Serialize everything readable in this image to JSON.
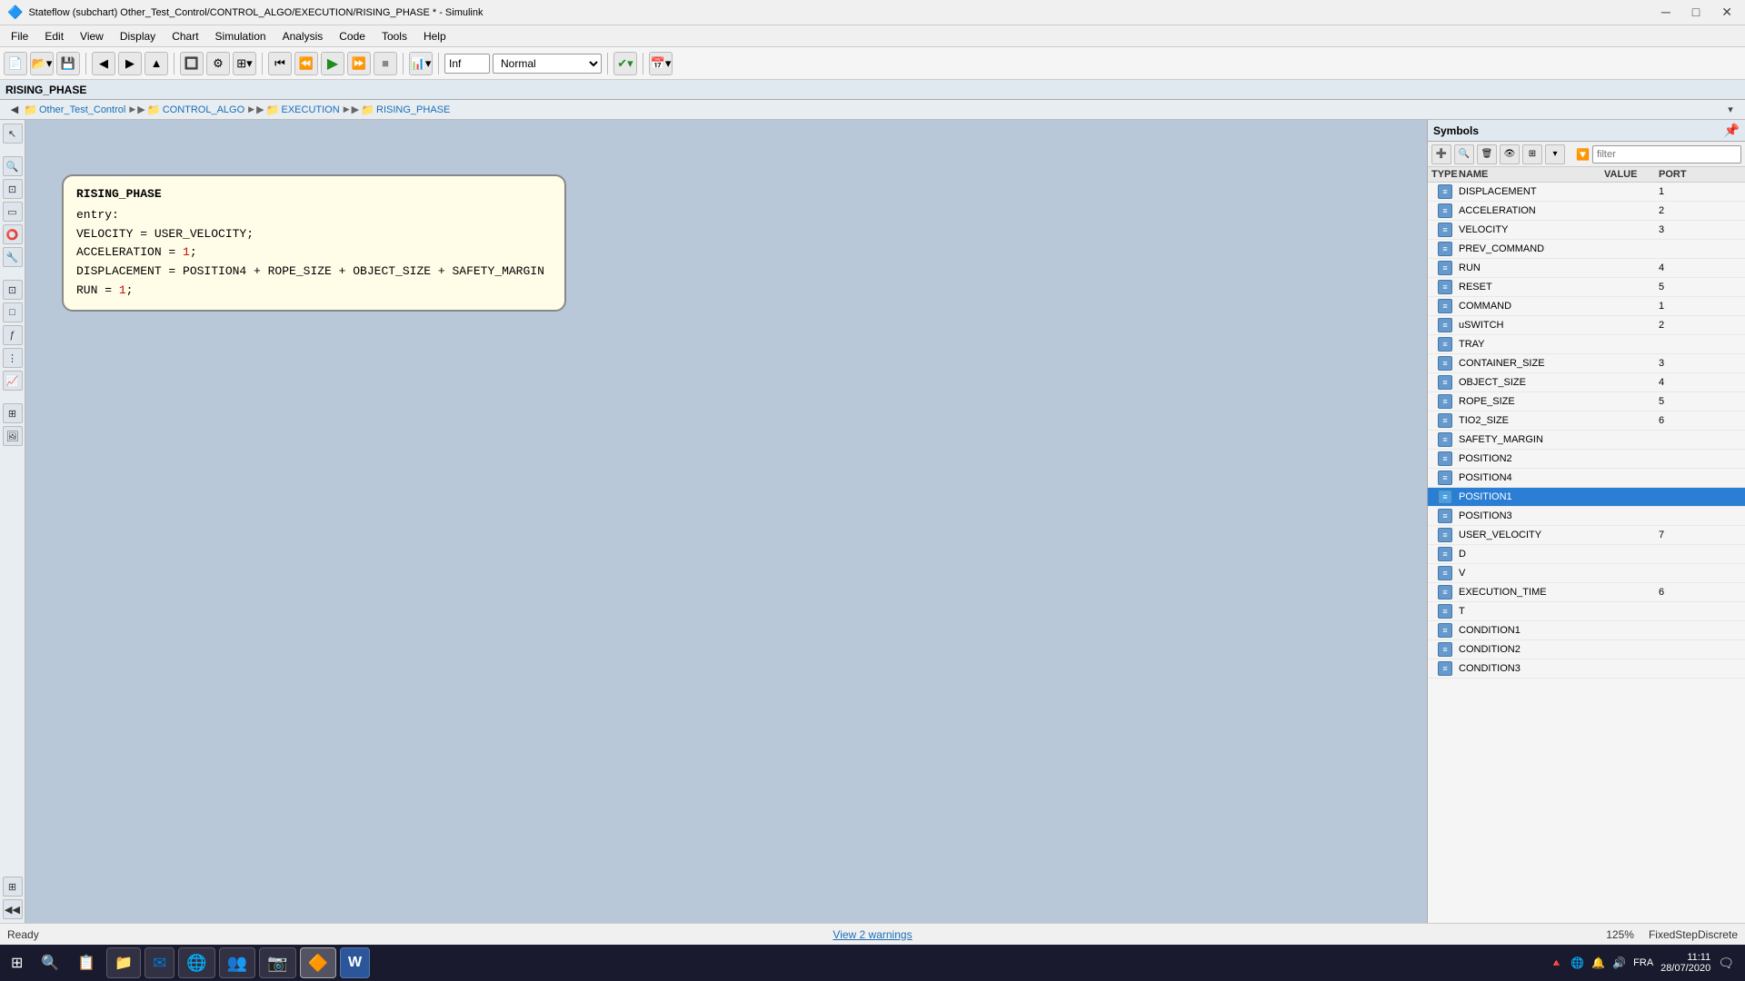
{
  "titlebar": {
    "title": "Stateflow (subchart) Other_Test_Control/CONTROL_ALGO/EXECUTION/RISING_PHASE * - Simulink",
    "icon": "🔷",
    "minimize": "─",
    "maximize": "□",
    "close": "✕"
  },
  "menubar": {
    "items": [
      "File",
      "Edit",
      "View",
      "Display",
      "Chart",
      "Simulation",
      "Analysis",
      "Code",
      "Tools",
      "Help"
    ]
  },
  "toolbar": {
    "sim_time_label": "Inf",
    "mode_label": "Normal"
  },
  "window_name": "RISING_PHASE",
  "breadcrumb": {
    "items": [
      {
        "label": "Other_Test_Control",
        "has_icon": true
      },
      {
        "label": "CONTROL_ALGO",
        "has_icon": true
      },
      {
        "label": "EXECUTION",
        "has_icon": true
      },
      {
        "label": "RISING_PHASE",
        "has_icon": true
      }
    ]
  },
  "state_block": {
    "title": "RISING_PHASE",
    "lines": [
      "entry:",
      "VELOCITY = USER_VELOCITY;",
      "ACCELERATION = 1;",
      "DISPLACEMENT = POSITION4 + ROPE_SIZE + OBJECT_SIZE + SAFETY_MARGIN",
      "RUN = 1;"
    ],
    "highlight_positions": [
      {
        "line": 2,
        "text": "1",
        "col": 14
      },
      {
        "line": 4,
        "text": "1",
        "col": 6
      }
    ]
  },
  "symbols_panel": {
    "title": "Symbols",
    "columns": [
      "TYPE",
      "NAME",
      "VALUE",
      "PORT"
    ],
    "filter_placeholder": "filter",
    "rows": [
      {
        "name": "DISPLACEMENT",
        "value": "",
        "port": "1",
        "selected": false
      },
      {
        "name": "ACCELERATION",
        "value": "",
        "port": "2",
        "selected": false
      },
      {
        "name": "VELOCITY",
        "value": "",
        "port": "3",
        "selected": false
      },
      {
        "name": "PREV_COMMAND",
        "value": "",
        "port": "",
        "selected": false
      },
      {
        "name": "RUN",
        "value": "",
        "port": "4",
        "selected": false
      },
      {
        "name": "RESET",
        "value": "",
        "port": "5",
        "selected": false
      },
      {
        "name": "COMMAND",
        "value": "",
        "port": "1",
        "selected": false
      },
      {
        "name": "uSWITCH",
        "value": "",
        "port": "2",
        "selected": false
      },
      {
        "name": "TRAY",
        "value": "",
        "port": "",
        "selected": false
      },
      {
        "name": "CONTAINER_SIZE",
        "value": "",
        "port": "3",
        "selected": false
      },
      {
        "name": "OBJECT_SIZE",
        "value": "",
        "port": "4",
        "selected": false
      },
      {
        "name": "ROPE_SIZE",
        "value": "",
        "port": "5",
        "selected": false
      },
      {
        "name": "TIO2_SIZE",
        "value": "",
        "port": "6",
        "selected": false
      },
      {
        "name": "SAFETY_MARGIN",
        "value": "",
        "port": "",
        "selected": false
      },
      {
        "name": "POSITION2",
        "value": "",
        "port": "",
        "selected": false
      },
      {
        "name": "POSITION4",
        "value": "",
        "port": "",
        "selected": false
      },
      {
        "name": "POSITION1",
        "value": "",
        "port": "",
        "selected": true
      },
      {
        "name": "POSITION3",
        "value": "",
        "port": "",
        "selected": false
      },
      {
        "name": "USER_VELOCITY",
        "value": "",
        "port": "7",
        "selected": false
      },
      {
        "name": "D",
        "value": "",
        "port": "",
        "selected": false
      },
      {
        "name": "V",
        "value": "",
        "port": "",
        "selected": false
      },
      {
        "name": "EXECUTION_TIME",
        "value": "",
        "port": "6",
        "selected": false
      },
      {
        "name": "T",
        "value": "",
        "port": "",
        "selected": false
      },
      {
        "name": "CONDITION1",
        "value": "",
        "port": "",
        "selected": false
      },
      {
        "name": "CONDITION2",
        "value": "",
        "port": "",
        "selected": false
      },
      {
        "name": "CONDITION3",
        "value": "",
        "port": "",
        "selected": false
      }
    ]
  },
  "statusbar": {
    "ready": "Ready",
    "warning": "View 2 warnings",
    "zoom": "125%",
    "solver": "FixedStepDiscrete"
  },
  "taskbar": {
    "time": "11:11",
    "date": "28/07/2020",
    "lang": "FRA",
    "apps": [
      {
        "icon": "⊞",
        "label": "Start"
      },
      {
        "icon": "🔍",
        "label": "Search"
      },
      {
        "icon": "📋",
        "label": "TaskView"
      },
      {
        "icon": "📁",
        "label": "Explorer"
      },
      {
        "icon": "✉",
        "label": "Mail"
      },
      {
        "icon": "🌐",
        "label": "Chrome"
      },
      {
        "icon": "👥",
        "label": "Teams"
      },
      {
        "icon": "📷",
        "label": "Camera"
      },
      {
        "icon": "🔶",
        "label": "Matlab"
      },
      {
        "icon": "W",
        "label": "Word"
      }
    ],
    "tray_icons": [
      "🔺",
      "🌐",
      "🔔",
      "🔊"
    ]
  }
}
